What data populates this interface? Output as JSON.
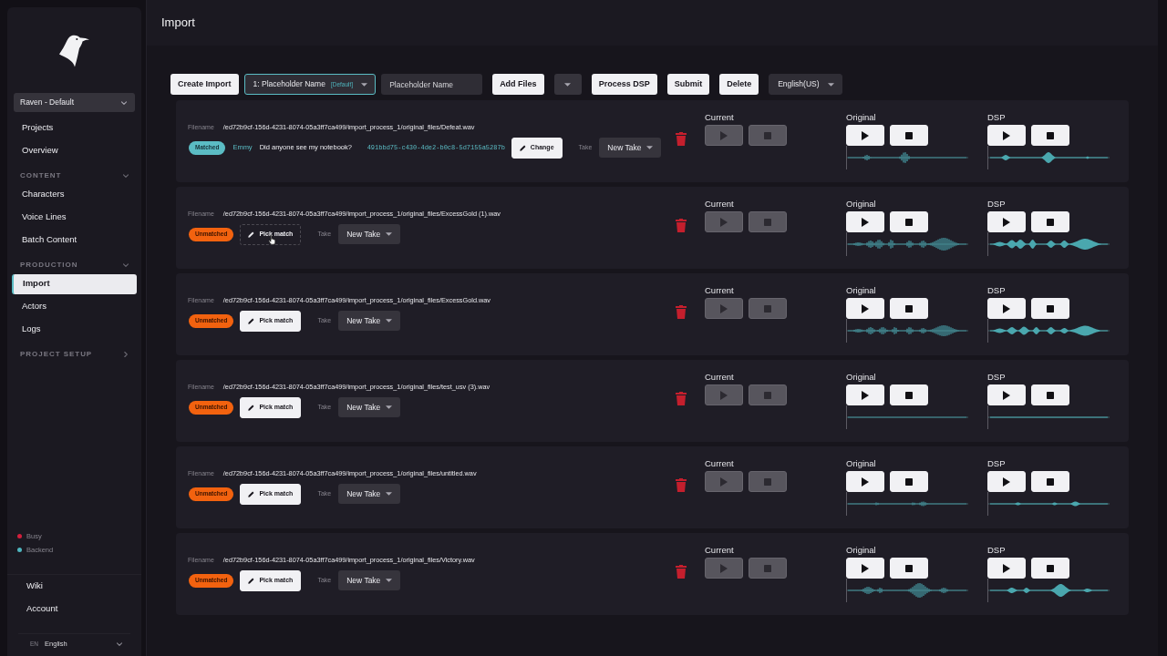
{
  "sidebar": {
    "project_select": {
      "value": "Raven - Default"
    },
    "nav": [
      {
        "kind": "item",
        "label": "Projects",
        "selected": false
      },
      {
        "kind": "item",
        "label": "Overview",
        "selected": false
      },
      {
        "kind": "section",
        "label": "CONTENT",
        "expanded": true
      },
      {
        "kind": "item",
        "label": "Characters",
        "selected": false
      },
      {
        "kind": "item",
        "label": "Voice Lines",
        "selected": false
      },
      {
        "kind": "item",
        "label": "Batch Content",
        "selected": false
      },
      {
        "kind": "section",
        "label": "PRODUCTION",
        "expanded": true
      },
      {
        "kind": "item",
        "label": "Import",
        "selected": true
      },
      {
        "kind": "item",
        "label": "Actors",
        "selected": false
      },
      {
        "kind": "item",
        "label": "Logs",
        "selected": false
      },
      {
        "kind": "section",
        "label": "PROJECT SETUP",
        "expanded": false
      }
    ],
    "status": [
      {
        "label": "Busy",
        "color": "#d21f3c"
      },
      {
        "label": "Backend",
        "color": "#4fb6bf"
      }
    ],
    "links": [
      "Wiki",
      "Account"
    ],
    "language": {
      "code": "EN",
      "value": "English"
    }
  },
  "page": {
    "title": "Import"
  },
  "toolbar": [
    {
      "kind": "button",
      "label": "Create Import"
    },
    {
      "kind": "select",
      "value": "1: Placeholder Name",
      "tag": "[Default]",
      "focused": true
    },
    {
      "kind": "input",
      "value": "Placeholder Name"
    },
    {
      "kind": "button",
      "label": "Add Files"
    },
    {
      "kind": "dropdown"
    },
    {
      "kind": "button",
      "label": "Process DSP"
    },
    {
      "kind": "button",
      "label": "Submit"
    },
    {
      "kind": "button",
      "label": "Delete"
    },
    {
      "kind": "select",
      "value": "English(US)",
      "focused": false
    }
  ],
  "rows": [
    {
      "filename_label": "Filename",
      "path": "/ed72b9cf-156d-4231-8074-05a3ff7ca499/import_process_1/original_files/Defeat.wav",
      "matched": true,
      "badge": "Matched",
      "match": {
        "character": "Emmy",
        "line": "Did anyone see my notebook?",
        "id": "491bbd75-c430-4de2-b0c8-5d7155a5287b"
      },
      "action": {
        "label": "Change",
        "hovered": false
      },
      "take_label": "Take",
      "take": "New Take",
      "players": [
        {
          "label": "Current",
          "disabled": true
        },
        {
          "label": "Original",
          "disabled": false
        },
        {
          "label": "DSP",
          "disabled": false
        }
      ]
    },
    {
      "filename_label": "Filename",
      "path": "/ed72b9cf-156d-4231-8074-05a3ff7ca499/import_process_1/original_files/ExcessGold (1).wav",
      "matched": false,
      "badge": "Unmatched",
      "action": {
        "label": "Pick match",
        "hovered": true
      },
      "take_label": "Take",
      "take": "New Take",
      "players": [
        {
          "label": "Current",
          "disabled": true
        },
        {
          "label": "Original",
          "disabled": false
        },
        {
          "label": "DSP",
          "disabled": false
        }
      ]
    },
    {
      "filename_label": "Filename",
      "path": "/ed72b9cf-156d-4231-8074-05a3ff7ca499/import_process_1/original_files/ExcessGold.wav",
      "matched": false,
      "badge": "Unmatched",
      "action": {
        "label": "Pick match",
        "hovered": false
      },
      "take_label": "Take",
      "take": "New Take",
      "players": [
        {
          "label": "Current",
          "disabled": true
        },
        {
          "label": "Original",
          "disabled": false
        },
        {
          "label": "DSP",
          "disabled": false
        }
      ]
    },
    {
      "filename_label": "Filename",
      "path": "/ed72b9cf-156d-4231-8074-05a3ff7ca499/import_process_1/original_files/test_usv (3).wav",
      "matched": false,
      "badge": "Unmatched",
      "action": {
        "label": "Pick match",
        "hovered": false
      },
      "take_label": "Take",
      "take": "New Take",
      "players": [
        {
          "label": "Current",
          "disabled": true
        },
        {
          "label": "Original",
          "disabled": false
        },
        {
          "label": "DSP",
          "disabled": false
        }
      ]
    },
    {
      "filename_label": "Filename",
      "path": "/ed72b9cf-156d-4231-8074-05a3ff7ca499/import_process_1/original_files/untitled.wav",
      "matched": false,
      "badge": "Unmatched",
      "action": {
        "label": "Pick match",
        "hovered": false
      },
      "take_label": "Take",
      "take": "New Take",
      "players": [
        {
          "label": "Current",
          "disabled": true
        },
        {
          "label": "Original",
          "disabled": false
        },
        {
          "label": "DSP",
          "disabled": false
        }
      ]
    },
    {
      "filename_label": "Filename",
      "path": "/ed72b9cf-156d-4231-8074-05a3ff7ca499/import_process_1/original_files/Victory.wav",
      "matched": false,
      "badge": "Unmatched",
      "action": {
        "label": "Pick match",
        "hovered": false
      },
      "take_label": "Take",
      "take": "New Take",
      "players": [
        {
          "label": "Current",
          "disabled": true
        },
        {
          "label": "Original",
          "disabled": false
        },
        {
          "label": "DSP",
          "disabled": false
        }
      ]
    }
  ]
}
